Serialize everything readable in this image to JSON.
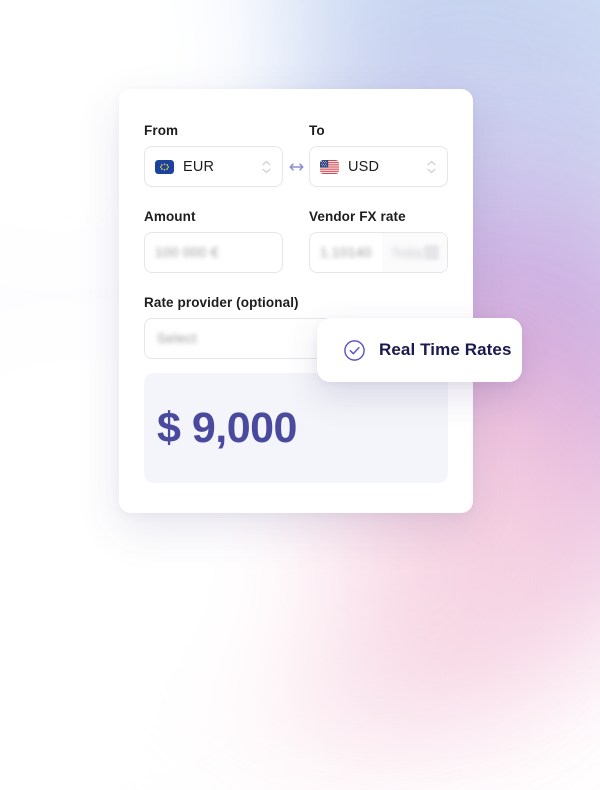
{
  "background": {
    "colors": {
      "top_left": "#fdfdff",
      "top_right": "#c3d3f0",
      "mid_right": "#c9a6de",
      "bottom_right": "#f8d9e4",
      "bottom_left": "#ffffff"
    }
  },
  "card": {
    "from": {
      "label": "From",
      "flag_icon": "eu-flag-icon",
      "currency": "EUR",
      "stepper_icon": "chevron-up-down-icon"
    },
    "swap": {
      "icon": "swap-horizontal-icon"
    },
    "to": {
      "label": "To",
      "flag_icon": "us-flag-icon",
      "currency": "USD",
      "stepper_icon": "chevron-up-down-icon"
    },
    "amount": {
      "label": "Amount",
      "value": "100 000 €",
      "placeholder": "100 000 €"
    },
    "vendor_fx": {
      "label": "Vendor FX rate",
      "rate_value": "1.10140",
      "date_value": "Today",
      "calendar_icon": "calendar-icon"
    },
    "rate_provider": {
      "label": "Rate provider (optional)",
      "placeholder": "Select",
      "value": "Select",
      "chevron_icon": "chevron-up-icon"
    },
    "result": {
      "amount": "$ 9,000",
      "accent_color": "#494a9d"
    }
  },
  "toast": {
    "icon": "check-circle-icon",
    "label": "Real Time Rates",
    "icon_color": "#5b56c4",
    "text_color": "#191a4d"
  }
}
